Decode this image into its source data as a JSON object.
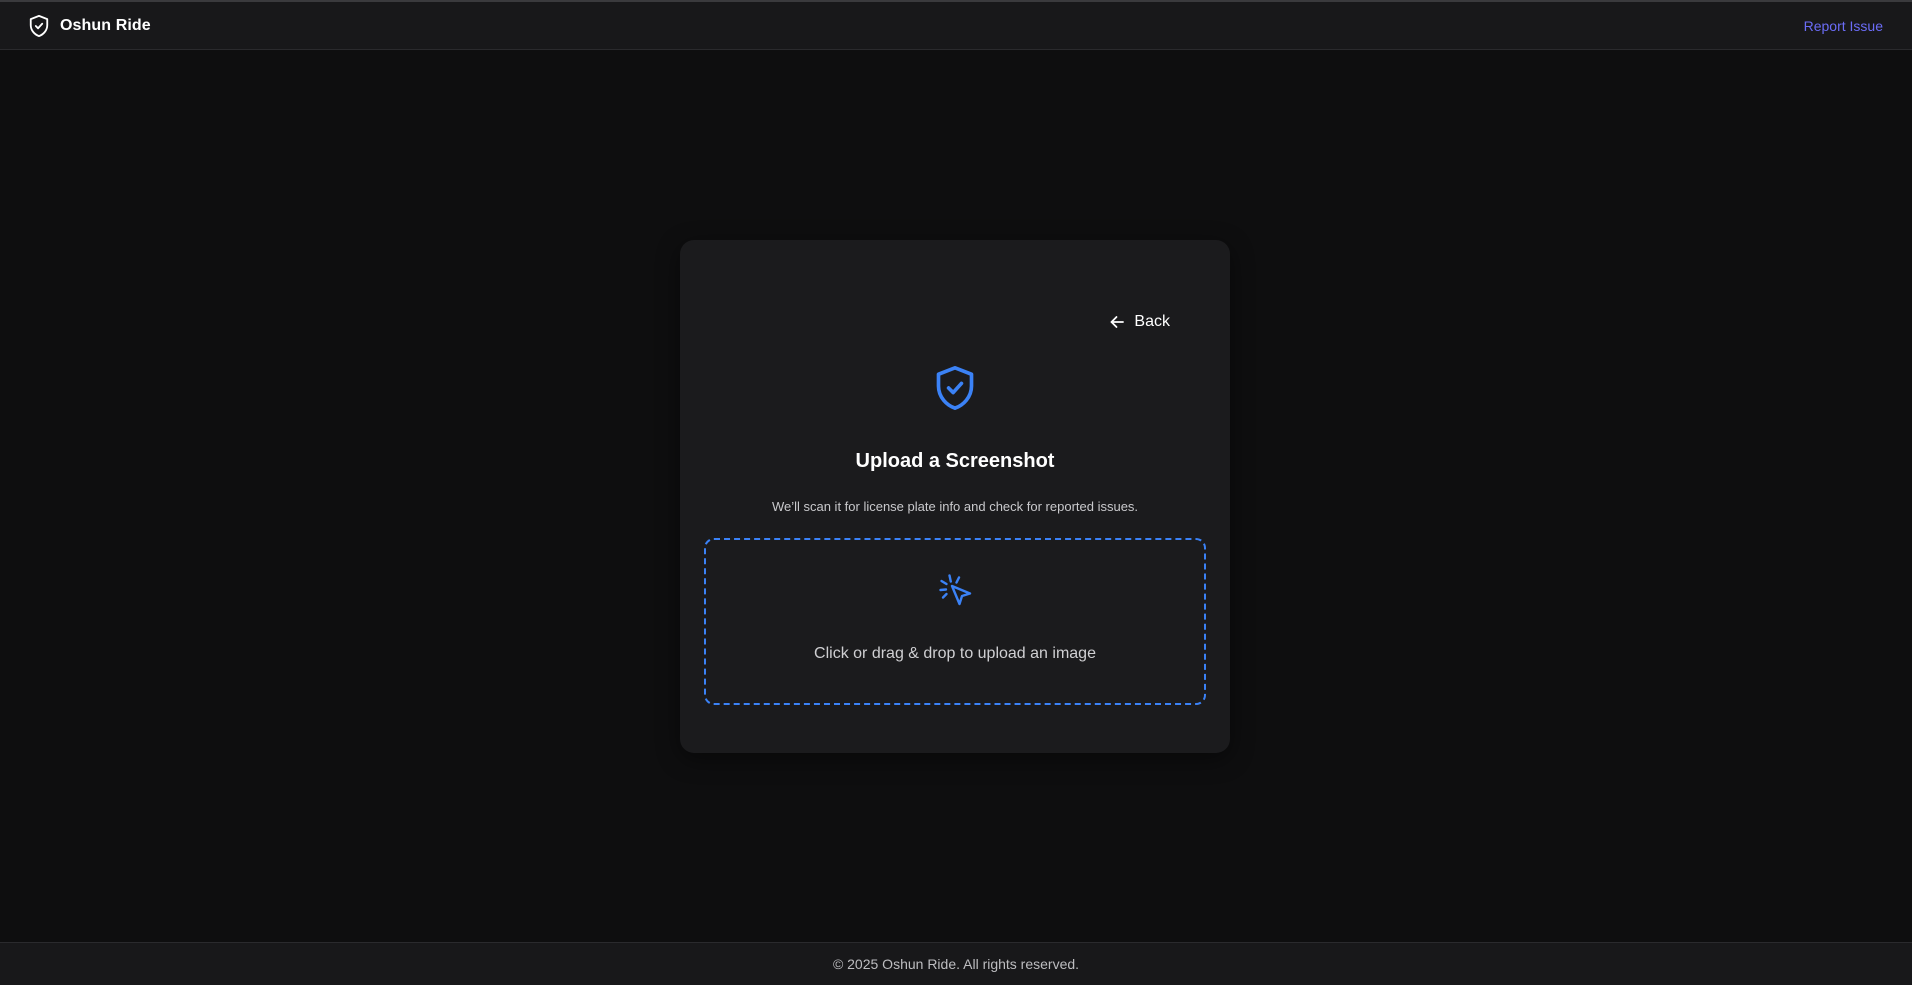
{
  "header": {
    "brand_name": "Oshun Ride",
    "brand_icon": "shield-check-icon",
    "report_link": "Report Issue"
  },
  "card": {
    "back_label": "Back",
    "back_icon": "arrow-left-icon",
    "hero_icon": "shield-check-icon",
    "title": "Upload a Screenshot",
    "subtitle": "We’ll scan it for license plate info and check for reported issues.",
    "dropzone": {
      "icon": "pointer-click-icon",
      "text": "Click or drag & drop to upload an image"
    }
  },
  "footer": {
    "copyright": "© 2025 Oshun Ride. All rights reserved."
  },
  "colors": {
    "background": "#0e0e0f",
    "surface": "#1b1b1d",
    "bar": "#18181a",
    "accent_blue": "#3b82f6",
    "link_indigo": "#6b6cf6"
  }
}
